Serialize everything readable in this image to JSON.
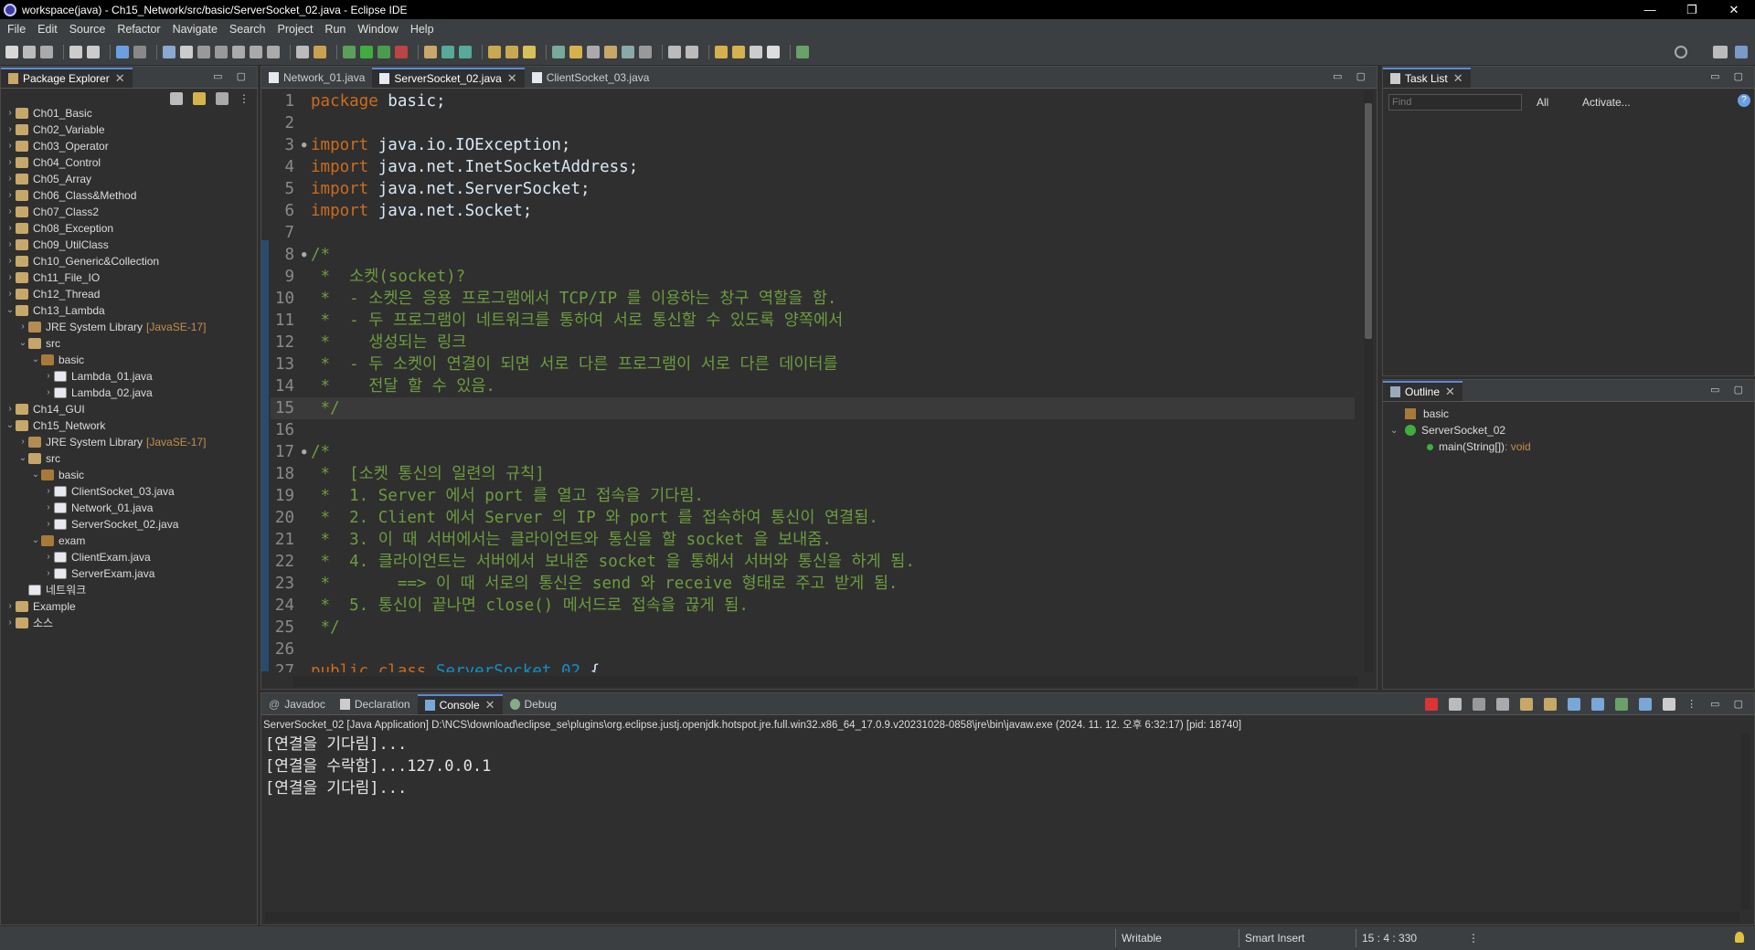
{
  "window": {
    "title": "workspace(java) - Ch15_Network/src/basic/ServerSocket_02.java - Eclipse IDE",
    "controls": [
      "—",
      "❐",
      "✕"
    ]
  },
  "menu": [
    "File",
    "Edit",
    "Source",
    "Refactor",
    "Navigate",
    "Search",
    "Project",
    "Run",
    "Window",
    "Help"
  ],
  "package_explorer": {
    "tab_label": "Package Explorer",
    "items": [
      {
        "depth": 0,
        "arrow": "›",
        "icon": "project-icon",
        "label": "Ch01_Basic",
        "suffix": ""
      },
      {
        "depth": 0,
        "arrow": "›",
        "icon": "project-icon",
        "label": "Ch02_Variable",
        "suffix": ""
      },
      {
        "depth": 0,
        "arrow": "›",
        "icon": "project-icon",
        "label": "Ch03_Operator",
        "suffix": ""
      },
      {
        "depth": 0,
        "arrow": "›",
        "icon": "project-icon",
        "label": "Ch04_Control",
        "suffix": ""
      },
      {
        "depth": 0,
        "arrow": "›",
        "icon": "project-icon",
        "label": "Ch05_Array",
        "suffix": ""
      },
      {
        "depth": 0,
        "arrow": "›",
        "icon": "project-icon",
        "label": "Ch06_Class&Method",
        "suffix": ""
      },
      {
        "depth": 0,
        "arrow": "›",
        "icon": "project-icon",
        "label": "Ch07_Class2",
        "suffix": ""
      },
      {
        "depth": 0,
        "arrow": "›",
        "icon": "project-icon",
        "label": "Ch08_Exception",
        "suffix": ""
      },
      {
        "depth": 0,
        "arrow": "›",
        "icon": "project-icon",
        "label": "Ch09_UtilClass",
        "suffix": ""
      },
      {
        "depth": 0,
        "arrow": "›",
        "icon": "project-icon",
        "label": "Ch10_Generic&Collection",
        "suffix": ""
      },
      {
        "depth": 0,
        "arrow": "›",
        "icon": "project-icon",
        "label": "Ch11_File_IO",
        "suffix": ""
      },
      {
        "depth": 0,
        "arrow": "›",
        "icon": "project-icon",
        "label": "Ch12_Thread",
        "suffix": ""
      },
      {
        "depth": 0,
        "arrow": "⌄",
        "icon": "project-icon",
        "label": "Ch13_Lambda",
        "suffix": ""
      },
      {
        "depth": 1,
        "arrow": "›",
        "icon": "jre-icon",
        "label": "JRE System Library",
        "suffix": "[JavaSE-17]"
      },
      {
        "depth": 1,
        "arrow": "⌄",
        "icon": "src-folder-icon",
        "label": "src",
        "suffix": ""
      },
      {
        "depth": 2,
        "arrow": "⌄",
        "icon": "package-icon",
        "label": "basic",
        "suffix": ""
      },
      {
        "depth": 3,
        "arrow": "›",
        "icon": "java-file-icon",
        "label": "Lambda_01.java",
        "suffix": ""
      },
      {
        "depth": 3,
        "arrow": "›",
        "icon": "java-file-icon",
        "label": "Lambda_02.java",
        "suffix": ""
      },
      {
        "depth": 0,
        "arrow": "›",
        "icon": "project-icon",
        "label": "Ch14_GUI",
        "suffix": ""
      },
      {
        "depth": 0,
        "arrow": "⌄",
        "icon": "project-icon",
        "label": "Ch15_Network",
        "suffix": ""
      },
      {
        "depth": 1,
        "arrow": "›",
        "icon": "jre-icon",
        "label": "JRE System Library",
        "suffix": "[JavaSE-17]"
      },
      {
        "depth": 1,
        "arrow": "⌄",
        "icon": "src-folder-icon",
        "label": "src",
        "suffix": ""
      },
      {
        "depth": 2,
        "arrow": "⌄",
        "icon": "package-icon",
        "label": "basic",
        "suffix": ""
      },
      {
        "depth": 3,
        "arrow": "›",
        "icon": "java-file-icon",
        "label": "ClientSocket_03.java",
        "suffix": ""
      },
      {
        "depth": 3,
        "arrow": "›",
        "icon": "java-file-icon",
        "label": "Network_01.java",
        "suffix": ""
      },
      {
        "depth": 3,
        "arrow": "›",
        "icon": "java-file-icon",
        "label": "ServerSocket_02.java",
        "suffix": ""
      },
      {
        "depth": 2,
        "arrow": "⌄",
        "icon": "package-icon",
        "label": "exam",
        "suffix": ""
      },
      {
        "depth": 3,
        "arrow": "›",
        "icon": "java-file-icon",
        "label": "ClientExam.java",
        "suffix": ""
      },
      {
        "depth": 3,
        "arrow": "›",
        "icon": "java-file-icon",
        "label": "ServerExam.java",
        "suffix": ""
      },
      {
        "depth": 1,
        "arrow": "",
        "icon": "file-icon",
        "label": "네트워크",
        "suffix": ""
      },
      {
        "depth": 0,
        "arrow": "›",
        "icon": "project-icon",
        "label": "Example",
        "suffix": ""
      },
      {
        "depth": 0,
        "arrow": "›",
        "icon": "project-icon",
        "label": "소스",
        "suffix": ""
      }
    ]
  },
  "editor": {
    "tabs": [
      {
        "label": "Network_01.java",
        "active": false
      },
      {
        "label": "ServerSocket_02.java",
        "active": true
      },
      {
        "label": "ClientSocket_03.java",
        "active": false
      }
    ],
    "lines": [
      {
        "n": "1",
        "fold": "",
        "parts": [
          [
            "kw",
            "package"
          ],
          [
            "tx",
            " basic;"
          ]
        ]
      },
      {
        "n": "2",
        "fold": "",
        "parts": []
      },
      {
        "n": "3",
        "fold": "●",
        "parts": [
          [
            "kw",
            "import"
          ],
          [
            "tx",
            " java.io.IOException;"
          ]
        ]
      },
      {
        "n": "4",
        "fold": "",
        "parts": [
          [
            "kw",
            "import"
          ],
          [
            "tx",
            " java.net.InetSocketAddress;"
          ]
        ]
      },
      {
        "n": "5",
        "fold": "",
        "parts": [
          [
            "kw",
            "import"
          ],
          [
            "tx",
            " java.net.ServerSocket;"
          ]
        ]
      },
      {
        "n": "6",
        "fold": "",
        "parts": [
          [
            "kw",
            "import"
          ],
          [
            "tx",
            " java.net.Socket;"
          ]
        ]
      },
      {
        "n": "7",
        "fold": "",
        "parts": []
      },
      {
        "n": "8",
        "fold": "●",
        "parts": [
          [
            "cmt",
            "/*"
          ]
        ]
      },
      {
        "n": "9",
        "fold": "",
        "parts": [
          [
            "cmt",
            " *  소켓(socket)?"
          ]
        ]
      },
      {
        "n": "10",
        "fold": "",
        "parts": [
          [
            "cmt",
            " *  - 소켓은 응용 프로그램에서 TCP/IP 를 이용하는 창구 역할을 함."
          ]
        ]
      },
      {
        "n": "11",
        "fold": "",
        "parts": [
          [
            "cmt",
            " *  - 두 프로그램이 네트워크를 통하여 서로 통신할 수 있도록 양쪽에서"
          ]
        ]
      },
      {
        "n": "12",
        "fold": "",
        "parts": [
          [
            "cmt",
            " *    생성되는 링크"
          ]
        ]
      },
      {
        "n": "13",
        "fold": "",
        "parts": [
          [
            "cmt",
            " *  - 두 소켓이 연결이 되면 서로 다른 프로그램이 서로 다른 데이터를"
          ]
        ]
      },
      {
        "n": "14",
        "fold": "",
        "parts": [
          [
            "cmt",
            " *    전달 할 수 있음."
          ]
        ]
      },
      {
        "n": "15",
        "fold": "",
        "parts": [
          [
            "cmt",
            " */"
          ]
        ],
        "current": true
      },
      {
        "n": "16",
        "fold": "",
        "parts": []
      },
      {
        "n": "17",
        "fold": "●",
        "parts": [
          [
            "cmt",
            "/*"
          ]
        ]
      },
      {
        "n": "18",
        "fold": "",
        "parts": [
          [
            "cmt",
            " *  [소켓 통신의 일련의 규칙]"
          ]
        ]
      },
      {
        "n": "19",
        "fold": "",
        "parts": [
          [
            "cmt",
            " *  1. Server 에서 port 를 열고 접속을 기다림."
          ]
        ]
      },
      {
        "n": "20",
        "fold": "",
        "parts": [
          [
            "cmt",
            " *  2. Client 에서 Server 의 IP 와 port 를 접속하여 통신이 연결됨."
          ]
        ]
      },
      {
        "n": "21",
        "fold": "",
        "parts": [
          [
            "cmt",
            " *  3. 이 때 서버에서는 클라이언트와 통신을 할 socket 을 보내줌."
          ]
        ]
      },
      {
        "n": "22",
        "fold": "",
        "parts": [
          [
            "cmt",
            " *  4. 클라이언트는 서버에서 보내준 socket 을 통해서 서버와 통신을 하게 됨."
          ]
        ]
      },
      {
        "n": "23",
        "fold": "",
        "parts": [
          [
            "cmt",
            " *       ==> 이 때 서로의 통신은 send 와 receive 형태로 주고 받게 됨."
          ]
        ]
      },
      {
        "n": "24",
        "fold": "",
        "parts": [
          [
            "cmt",
            " *  5. 통신이 끝나면 close() 메서드로 접속을 끊게 됨."
          ]
        ]
      },
      {
        "n": "25",
        "fold": "",
        "parts": [
          [
            "cmt",
            " */"
          ]
        ]
      },
      {
        "n": "26",
        "fold": "",
        "parts": []
      },
      {
        "n": "27",
        "fold": "",
        "parts": [
          [
            "kw",
            "public"
          ],
          [
            "tx",
            " "
          ],
          [
            "kw",
            "class"
          ],
          [
            "tx",
            " "
          ],
          [
            "cls",
            "ServerSocket_02"
          ],
          [
            "tx",
            " {"
          ]
        ]
      }
    ]
  },
  "task_list": {
    "tab_label": "Task List",
    "find_placeholder": "Find",
    "all_label": "All",
    "activate_label": "Activate..."
  },
  "outline": {
    "tab_label": "Outline",
    "package": "basic",
    "class_name": "ServerSocket_02",
    "method": "main(String[])",
    "method_type": " : void"
  },
  "bottom_tabs": [
    {
      "label": "Javadoc",
      "active": false
    },
    {
      "label": "Declaration",
      "active": false
    },
    {
      "label": "Console",
      "active": true
    },
    {
      "label": "Debug",
      "active": false
    }
  ],
  "console": {
    "header": "ServerSocket_02 [Java Application] D:\\NCS\\download\\eclipse_se\\plugins\\org.eclipse.justj.openjdk.hotspot.jre.full.win32.x86_64_17.0.9.v20231028-0858\\jre\\bin\\javaw.exe  (2024. 11. 12. 오후 6:32:17) [pid: 18740]",
    "lines": [
      "[연결을 기다림]...",
      "[연결을 수락함]...127.0.0.1",
      "[연결을 기다림]..."
    ]
  },
  "status": {
    "writable": "Writable",
    "insert_mode": "Smart Insert",
    "position": "15 : 4 : 330"
  },
  "colors": {
    "keyword": "#cc6c1d",
    "comment": "#6c9c3f",
    "class_name": "#1290c3",
    "accent": "#5a8ad6"
  }
}
